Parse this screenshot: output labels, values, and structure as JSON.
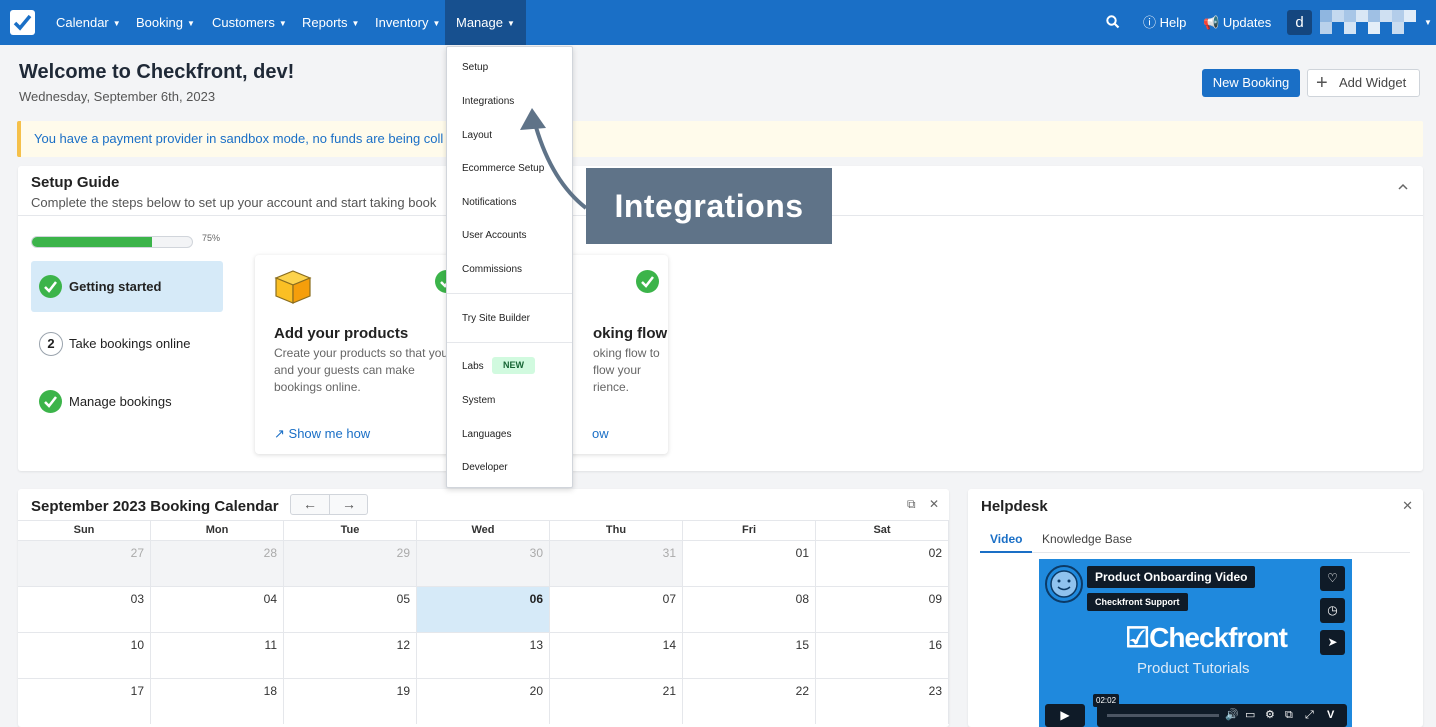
{
  "nav": {
    "items": [
      {
        "label": "Calendar"
      },
      {
        "label": "Booking"
      },
      {
        "label": "Customers"
      },
      {
        "label": "Reports"
      },
      {
        "label": "Inventory"
      },
      {
        "label": "Manage"
      }
    ],
    "help": "Help",
    "updates": "Updates",
    "avatar": "d"
  },
  "header": {
    "title": "Welcome to Checkfront, dev!",
    "date": "Wednesday, September 6th, 2023",
    "new_booking": "New Booking",
    "add_widget": "Add Widget"
  },
  "alert": {
    "text": "You have a payment provider in sandbox mode, no funds are being coll"
  },
  "setup": {
    "title": "Setup Guide",
    "subtitle": "Complete the steps below to set up your account and start taking book",
    "progress": 0.75,
    "progress_label": "75%",
    "steps": [
      {
        "label": "Getting started",
        "status": "done"
      },
      {
        "label": "Take bookings online",
        "number": "2"
      },
      {
        "label": "Manage bookings",
        "status": "done"
      }
    ],
    "cards": [
      {
        "title": "Add your products",
        "desc": "Create your products so that you and your guests can make bookings online.",
        "link": "Show me how"
      },
      {
        "title": "oking flow",
        "desc": "oking flow to flow your rience.",
        "link": "ow"
      }
    ]
  },
  "calendar": {
    "title": "September 2023 Booking Calendar",
    "prev": "←",
    "next": "→",
    "days": [
      "Sun",
      "Mon",
      "Tue",
      "Wed",
      "Thu",
      "Fri",
      "Sat"
    ],
    "weeks": [
      [
        "27",
        "28",
        "29",
        "30",
        "31",
        "01",
        "02"
      ],
      [
        "03",
        "04",
        "05",
        "06",
        "07",
        "08",
        "09"
      ],
      [
        "10",
        "11",
        "12",
        "13",
        "14",
        "15",
        "16"
      ],
      [
        "17",
        "18",
        "19",
        "20",
        "21",
        "22",
        "23"
      ]
    ]
  },
  "helpdesk": {
    "title": "Helpdesk",
    "tabs": [
      "Video",
      "Knowledge Base"
    ],
    "video_title": "Product Onboarding Video",
    "video_channel": "Checkfront Support",
    "video_brand": "Checkfront",
    "video_tagline": "Product Tutorials",
    "video_time": "02:02"
  },
  "manage_menu": {
    "items": [
      "Setup",
      "Integrations",
      "Layout",
      "Ecommerce Setup",
      "Notifications",
      "User Accounts",
      "Commissions",
      "Try Site Builder",
      "Labs",
      "System",
      "Languages",
      "Developer"
    ],
    "labs_badge": "NEW"
  },
  "annotation": {
    "text": "Integrations"
  },
  "colors": {
    "primary": "#1a6fc6",
    "nav_active": "#17508f",
    "success": "#3cb44a",
    "callout": "#5f7388"
  }
}
